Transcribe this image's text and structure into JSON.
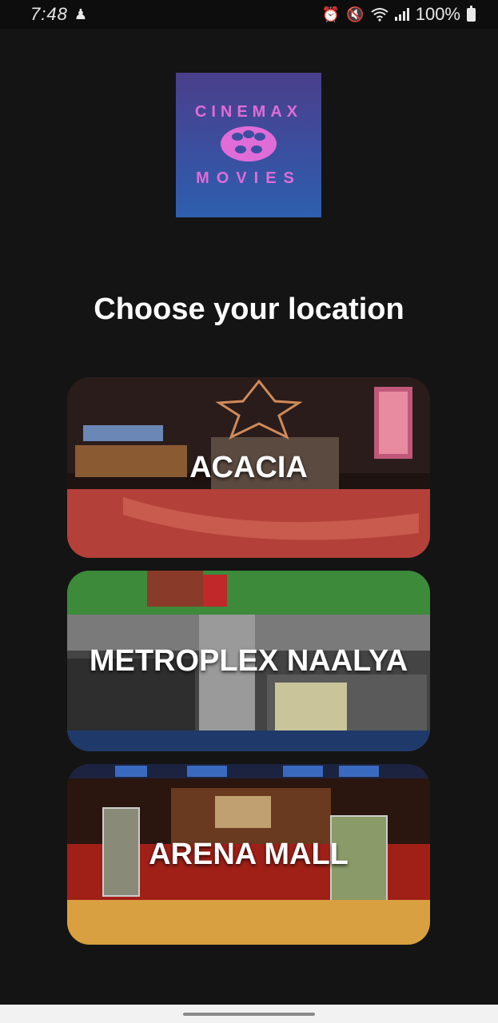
{
  "status_bar": {
    "time": "7:48",
    "battery": "100%"
  },
  "logo": {
    "arc_text": "CINEMAX",
    "sub_text": "MOVIES",
    "colors": {
      "text": "#e06cd8",
      "top": "#4a3f8a",
      "bottom": "#2d5fae"
    }
  },
  "heading": "Choose your location",
  "locations": [
    {
      "label": "ACACIA"
    },
    {
      "label": "METROPLEX NAALYA"
    },
    {
      "label": "ARENA MALL"
    }
  ],
  "icons": {
    "status_left": [
      "user-icon"
    ],
    "status_right": [
      "alarm-icon",
      "mute-icon",
      "wifi-icon",
      "signal-icon",
      "battery-icon"
    ]
  }
}
